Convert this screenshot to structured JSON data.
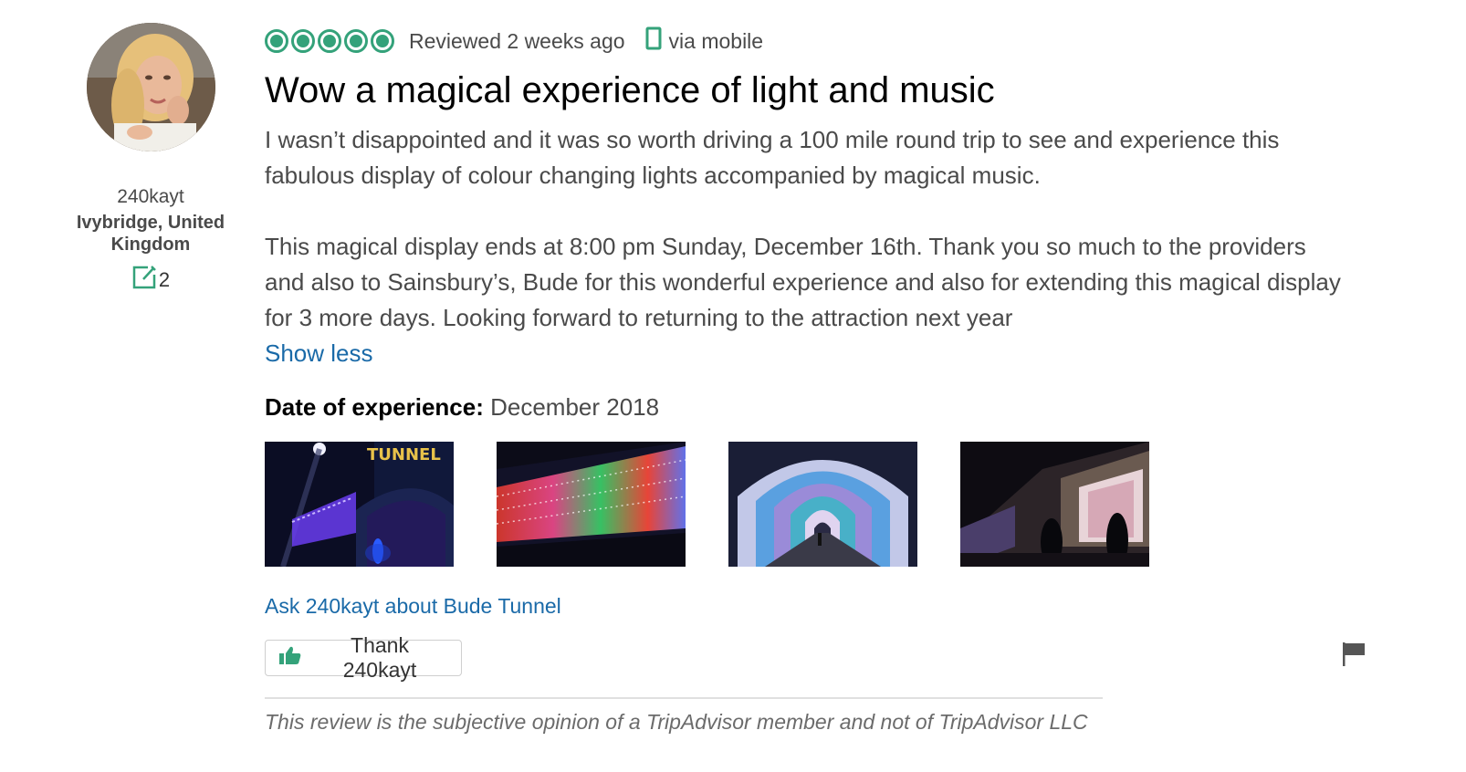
{
  "member": {
    "username": "240kayt",
    "location": "Ivybridge, United Kingdom",
    "contributions": "2",
    "contrib_icon": "edit-note-icon",
    "colors": {
      "accent": "#34a27a"
    }
  },
  "review": {
    "rating": 5,
    "rating_max": 5,
    "reviewed": "Reviewed 2 weeks ago",
    "via": "via mobile",
    "title": "Wow a magical experience of light and music",
    "paragraphs": [
      "I wasn’t disappointed and it was so worth driving a 100 mile round trip to see and experience this fabulous display of colour changing lights accompanied by magical music.",
      "This magical display ends at 8:00 pm Sunday, December 16th. Thank you so much to the providers and also to Sainsbury’s, Bude for this wonderful experience and also for extending this magical display for 3 more days. Looking forward to returning to the attraction next year"
    ],
    "show_less": "Show less",
    "date_label": "Date of experience:",
    "date_value": "December 2018",
    "photo_text": "TUNNEL",
    "ask": "Ask 240kayt about Bude Tunnel",
    "thank": "Thank 240kayt",
    "disclaimer": "This review is the subjective opinion of a TripAdvisor member and not of TripAdvisor LLC"
  },
  "colors": {
    "link": "#1a6aa8",
    "bubble": "#34a27a",
    "title": "#000000",
    "text": "#4a4a4a"
  }
}
